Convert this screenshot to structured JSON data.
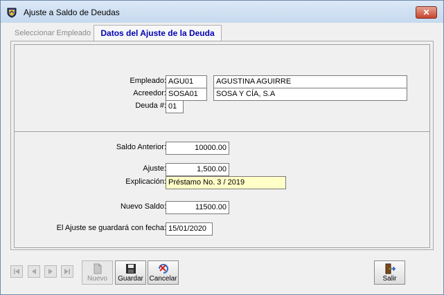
{
  "window": {
    "title": "Ajuste a Saldo de Deudas",
    "close_glyph": "✕"
  },
  "tabs": [
    {
      "label": "Seleccionar Empleado",
      "active": false
    },
    {
      "label": "Datos del Ajuste de la Deuda",
      "active": true
    }
  ],
  "header_group": {
    "empleado_label": "Empleado:",
    "empleado_code": "AGU01",
    "empleado_name": "AGUSTINA AGUIRRE",
    "acreedor_label": "Acreedor:",
    "acreedor_code": "SOSA01",
    "acreedor_name": "SOSA Y CÍA, S.A",
    "deuda_label": "Deuda #:",
    "deuda_value": "01"
  },
  "adjust_group": {
    "saldo_anterior_label": "Saldo Anterior:",
    "saldo_anterior_value": "10000.00",
    "ajuste_label": "Ajuste:",
    "ajuste_value": "1,500.00",
    "explicacion_label": "Explicación:",
    "explicacion_value": "Préstamo No. 3 / 2019",
    "nuevo_saldo_label": "Nuevo Saldo:",
    "nuevo_saldo_value": "11500.00",
    "fecha_label": "El Ajuste se guardará con fecha:",
    "fecha_value": "15/01/2020"
  },
  "toolbar": {
    "nav_icons": [
      "first-record-icon",
      "previous-record-icon",
      "next-record-icon",
      "last-record-icon"
    ],
    "nuevo_label": "Nuevo",
    "guardar_label": "Guardar",
    "cancelar_label": "Cancelar",
    "salir_label": "Salir"
  },
  "colors": {
    "active_tab_text": "#0000b4",
    "explicacion_bg": "#ffffc8",
    "close_button": "#c7442c"
  }
}
